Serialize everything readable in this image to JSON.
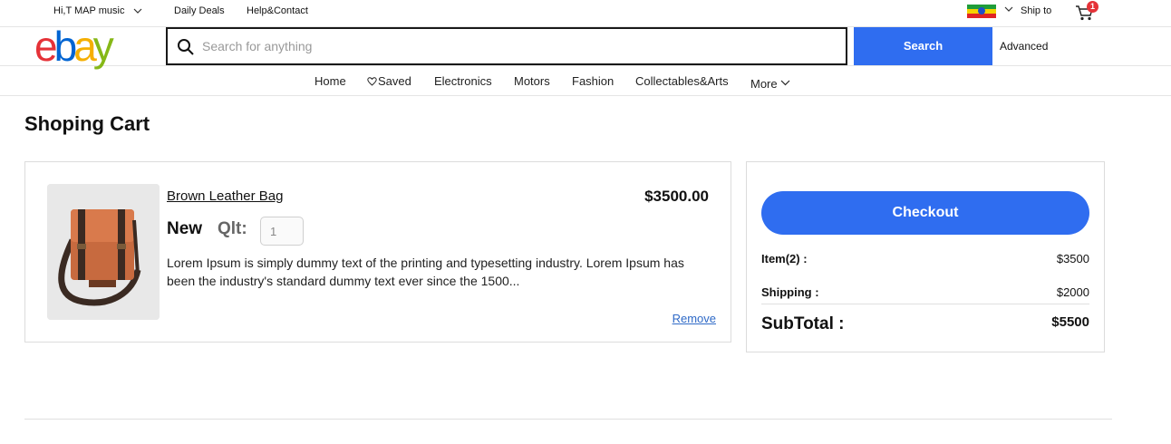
{
  "topbar": {
    "user_text": "Hi,T MAP music",
    "daily_deals": "Daily Deals",
    "help_contact": "Help&Contact",
    "ship_to": "Ship to",
    "cart_count": "1"
  },
  "header": {
    "logo_letters": [
      {
        "char": "e",
        "color": "#e53238"
      },
      {
        "char": "b",
        "color": "#0064d2"
      },
      {
        "char": "a",
        "color": "#f5af02"
      },
      {
        "char": "y",
        "color": "#86b817"
      }
    ],
    "search_placeholder": "Search for anything",
    "search_value": "",
    "search_button": "Search",
    "advanced": "Advanced"
  },
  "nav": {
    "items": [
      "Home",
      "Saved",
      "Electronics",
      "Motors",
      "Fashion",
      "Collectables&Arts",
      "More"
    ]
  },
  "page_title": "Shoping Cart",
  "cart_item": {
    "name": "Brown Leather Bag",
    "price": "$3500.00",
    "condition": "New",
    "qty_label": "Qlt:",
    "qty_value": "1",
    "description": "Lorem Ipsum is simply dummy text of the printing and typesetting industry. Lorem Ipsum has been the industry's standard dummy text ever since the 1500...",
    "remove": "Remove"
  },
  "summary": {
    "checkout": "Checkout",
    "items_label": "Item(2) :",
    "items_value": "$3500",
    "shipping_label": "Shipping :",
    "shipping_value": "$2000",
    "subtotal_label": "SubTotal :",
    "subtotal_value": "$5500"
  },
  "colors": {
    "primary_blue": "#2f6df0",
    "badge_red": "#e53238",
    "link_blue": "#2f6ac7"
  }
}
